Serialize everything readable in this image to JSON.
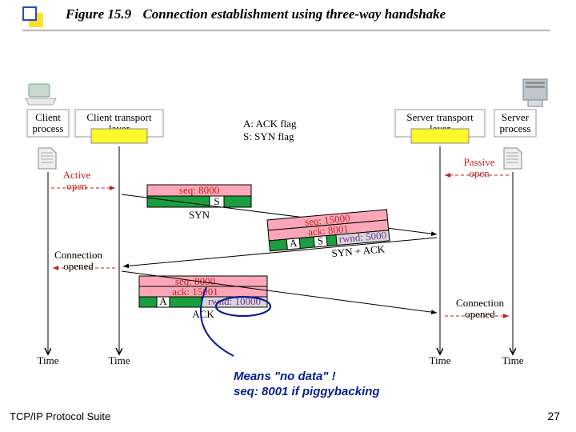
{
  "figure": {
    "number": "Figure 15.9",
    "caption": "Connection establishment using three-way handshake"
  },
  "legend": {
    "ack": "A: ACK flag",
    "syn": "S: SYN flag"
  },
  "entities": {
    "client_process": "Client process",
    "client_transport": "Client transport layer",
    "server_transport": "Server transport layer",
    "server_process": "Server process"
  },
  "opens": {
    "active": "Active open",
    "passive": "Passive open",
    "conn_opened_left": "Connection opened",
    "conn_opened_right": "Connection opened"
  },
  "segments": {
    "syn": {
      "seq": "seq: 8000",
      "flag": "S",
      "name": "SYN"
    },
    "synack": {
      "seq": "seq: 15000",
      "ack": "ack: 8001",
      "a": "A",
      "s": "S",
      "rwnd": "rwnd: 5000",
      "name": "SYN + ACK"
    },
    "ack": {
      "seq": "seq: 8000",
      "ackf": "ack: 15001",
      "a": "A",
      "rwnd": "rwnd: 10000",
      "name": "ACK"
    }
  },
  "callout": {
    "line1": "Means \"no data\" !",
    "line2": "seq: 8001 if piggybacking"
  },
  "axis": "Time",
  "footer": {
    "left": "TCP/IP Protocol Suite",
    "page": "27"
  },
  "colors": {
    "yellow": "#fff82a",
    "pink": "#fca7b8",
    "green": "#1a9e3e",
    "gray": "#d8d8d8",
    "box": "#999"
  }
}
